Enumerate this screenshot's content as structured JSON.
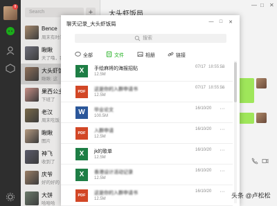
{
  "nav": {
    "badge": "8",
    "icons": [
      "chat-icon",
      "contacts-icon",
      "favorites-icon",
      "settings-icon"
    ],
    "accent": "#1aad19"
  },
  "session_list": {
    "search_placeholder": "Search",
    "add_label": "+",
    "chats": [
      {
        "name": "Bence",
        "preview": "周末有时间",
        "avatar_color": "#a88b6e",
        "selected": false
      },
      {
        "name": "瞅瞅",
        "preview": "天了噜，我",
        "avatar_color": "#6e6e7a",
        "selected": false
      },
      {
        "name": "大头虾饭局",
        "preview": "瞅瞅: 这",
        "avatar_color": "#8f6f59",
        "selected": true
      },
      {
        "name": "果西公主",
        "preview": "下班了",
        "avatar_color": "#c78f86",
        "selected": false
      },
      {
        "name": "老汉",
        "preview": "周末吃饭",
        "avatar_color": "#7a6a4a",
        "selected": false
      },
      {
        "name": "瞅瞅",
        "preview": "图片",
        "avatar_color": "#b59a80",
        "selected": false
      },
      {
        "name": "神飞",
        "preview": "收到了",
        "avatar_color": "#5b5b6b",
        "selected": false
      },
      {
        "name": "庆爷",
        "preview": "好的好的",
        "avatar_color": "#9b7f66",
        "selected": false
      },
      {
        "name": "大饼",
        "preview": "哈哈哈",
        "avatar_color": "#6b7b6b",
        "selected": false
      }
    ]
  },
  "chat_window": {
    "title": "大头虾饭局",
    "window_controls": [
      "—",
      "□",
      "✕"
    ]
  },
  "modal": {
    "title": "聊天记录_大头虾饭局",
    "window_controls": [
      "—",
      "□",
      "✕"
    ],
    "search_placeholder": "搜索",
    "filters": [
      {
        "label": "全部",
        "icon": "chat-bubble-icon",
        "active": false
      },
      {
        "label": "文件",
        "icon": "file-icon",
        "active": true
      },
      {
        "label": "相册",
        "icon": "image-icon",
        "active": false
      },
      {
        "label": "链接",
        "icon": "link-icon",
        "active": false
      }
    ],
    "files": [
      {
        "type": "X",
        "type_color": "#1e7e45",
        "name": "手绘麻将的海报招贴",
        "size": "12.5M",
        "date": "07/17",
        "time": "18:55:58",
        "blurred": false
      },
      {
        "type": "PDF",
        "type_color": "#d24726",
        "name": "这是你的入群申请书",
        "size": "12.5M",
        "date": "07/17",
        "time": "18:55:56",
        "blurred": true
      },
      {
        "type": "W",
        "type_color": "#2b579a",
        "name": "毕业论文",
        "size": "100.5M",
        "date": "16/10/20",
        "time": "",
        "blurred": true
      },
      {
        "type": "PDF",
        "type_color": "#d24726",
        "name": "入群申请",
        "size": "12.5M",
        "date": "16/10/20",
        "time": "",
        "blurred": true
      },
      {
        "type": "X",
        "type_color": "#1e7e45",
        "name": "jk的歌单",
        "size": "12.5M",
        "date": "16/10/20",
        "time": "",
        "blurred": false
      },
      {
        "type": "X",
        "type_color": "#1e7e45",
        "name": "香港设计活动记录",
        "size": "12.5M",
        "date": "16/10/20",
        "time": "",
        "blurred": true
      },
      {
        "type": "PDF",
        "type_color": "#d24726",
        "name": "这是你的入群申请书",
        "size": "12.5M",
        "date": "16/10/20",
        "time": "",
        "blurred": true
      }
    ],
    "more_label": "···"
  },
  "watermark": "头条 @卢松松"
}
